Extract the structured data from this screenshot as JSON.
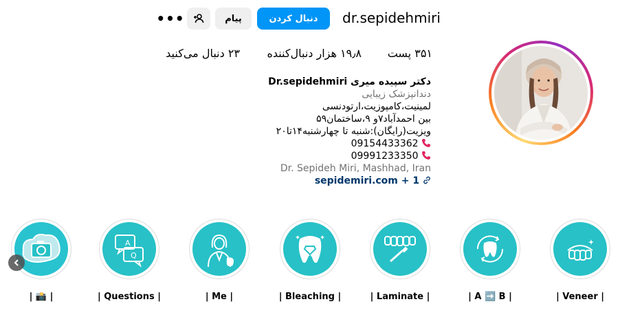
{
  "header": {
    "username": "dr.sepidehmiri",
    "follow_label": "دنبال کردن",
    "message_label": "پیام",
    "more_label": "•••"
  },
  "stats": {
    "posts": "۳۵۱ پست",
    "followers": "۱۹٫۸ هزار دنبال‌کننده",
    "following": "۲۳ دنبال می‌کنید"
  },
  "bio": {
    "name": "دکتر سپیده میری Dr.sepidehmiri",
    "category": "دندانپزشک زیبایی",
    "line1": "لمینیت،کامپوزیت،ارتودنسی",
    "line2": "بین احمدآباد۷و ۹،ساختمان۵۹",
    "line3": "ویزیت(رایگان):شنبه تا چهارشنبه۱۴تا۲۰",
    "phone1": "09154433362",
    "phone2": "09991233350",
    "location": "Dr. Sepideh Miri, Mashhad, Iran",
    "link": "sepidemiri.com + 1"
  },
  "highlights": [
    {
      "label": "| Veneer |",
      "icon": "veneer-teeth-icon"
    },
    {
      "label": "| A ➡️ B |",
      "icon": "tooth-cycle-icon"
    },
    {
      "label": "| Laminate |",
      "icon": "laminate-teeth-icon"
    },
    {
      "label": "| Bleaching |",
      "icon": "diamond-tooth-icon"
    },
    {
      "label": "| Me |",
      "icon": "doctor-woman-icon"
    },
    {
      "label": "| Questions |",
      "icon": "qa-bubbles-icon"
    },
    {
      "label": "| 📸 |",
      "icon": "camera-icon"
    }
  ],
  "colors": {
    "follow_button": "#0095f6",
    "secondary_button": "#efefef",
    "highlight_teal": "#27c1c7",
    "link": "#00376b",
    "muted": "#737373"
  }
}
